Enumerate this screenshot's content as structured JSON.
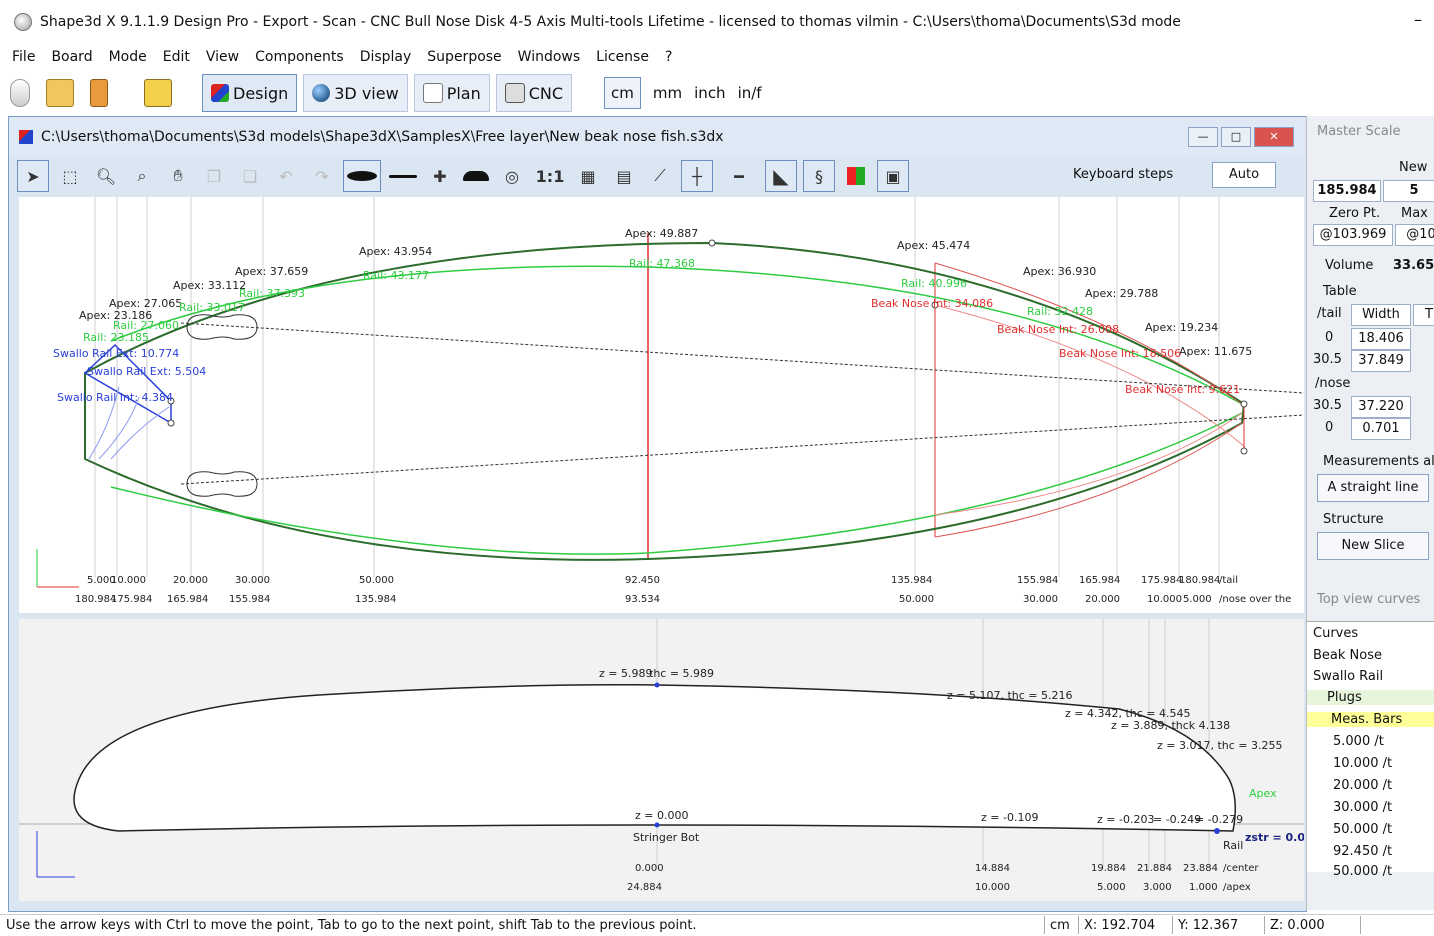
{
  "window": {
    "title": "Shape3d X 9.1.1.9 Design Pro - Export - Scan - CNC Bull Nose Disk 4-5 Axis Multi-tools Lifetime - licensed to thomas vilmin - C:\\Users\\thoma\\Documents\\S3d mode",
    "minimize": "–"
  },
  "menu": [
    "File",
    "Board",
    "Mode",
    "Edit",
    "View",
    "Components",
    "Display",
    "Superpose",
    "Windows",
    "License",
    "?"
  ],
  "modes": {
    "design": "Design",
    "view3d": "3D view",
    "plan": "Plan",
    "cnc": "CNC"
  },
  "units": [
    "cm",
    "mm",
    "inch",
    "in/f"
  ],
  "document": {
    "title": "C:\\Users\\thoma\\Documents\\S3d models\\Shape3dX\\SamplesX\\Free layer\\New beak nose fish.s3dx",
    "ratio_label": "1:1",
    "keyboard_steps": "Keyboard steps",
    "auto": "Auto"
  },
  "top_view": {
    "apex_labels": [
      "Apex: 49.887",
      "Apex: 45.474",
      "Apex: 43.954",
      "Apex: 37.659",
      "Apex: 33.112",
      "Apex: 27.065",
      "Apex: 23.186",
      "Apex: 36.930",
      "Apex: 29.788",
      "Apex: 19.234",
      "Apex: 11.675"
    ],
    "rail_labels": [
      "Rail: 47.368",
      "Rail: 43.177",
      "Rail: 37.393",
      "Rail: 33.017",
      "Rail: 27.060",
      "Rail: 23.185",
      "Rail: 40.996",
      "Rail: 32.428"
    ],
    "beak_labels": [
      "Beak Nose Int: 34.086",
      "Beak Nose Int: 26.008",
      "Beak Nose Int: 18.506",
      "Beak Nose Int: 9.621"
    ],
    "swallo_labels": [
      "Swallo Rail Ext: 10.774",
      "Swallo Rail Ext: 5.504",
      "Swallo Rail Int: 4.384"
    ],
    "tail_values": [
      "5.000",
      "10.000",
      "20.000",
      "30.000",
      "50.000",
      "92.450",
      "135.984",
      "155.984",
      "165.984",
      "175.984",
      "180.984"
    ],
    "nose_values": [
      "180.984",
      "175.984",
      "165.984",
      "155.984",
      "135.984",
      "93.534",
      "50.000",
      "30.000",
      "20.000",
      "10.000",
      "5.000"
    ],
    "tail_suffix": "/tail",
    "nose_suffix": "/nose over the"
  },
  "side_view": {
    "z_labels": [
      "z = 5.989",
      "thc = 5.989",
      "z = 5.107, thc = 5.216",
      "z = 4.342, thc = 4.545",
      "z = 3.889, thck 4.138",
      "z = 3.017, thc = 3.255",
      "z = 0.000",
      "z = -0.109",
      "z = -0.203",
      "= -0.249",
      "= -0.279",
      "Apex",
      "Rail",
      "zstr = 0.00",
      "Stringer Bot"
    ],
    "center_values": [
      "0.000",
      "14.884",
      "19.884",
      "21.884",
      "23.884"
    ],
    "apex_values": [
      "24.884",
      "10.000",
      "5.000",
      "3.000",
      "1.000"
    ],
    "center_suffix": "/center",
    "apex_suffix": "/apex"
  },
  "right_panel": {
    "master_scale": "Master Scale",
    "new": "New",
    "length": "185.984",
    "length2": "5",
    "zero_pt": "Zero Pt.",
    "max": "Max",
    "zero_val": "@103.969",
    "max_val": "@10",
    "volume_label": "Volume",
    "volume": "33.65",
    "table_label": "Table",
    "tail_col": "/tail",
    "width_col": "Width",
    "t_col": "T",
    "rows_tail": [
      [
        "0",
        "18.406"
      ],
      [
        "30.5",
        "37.849"
      ]
    ],
    "nose_label": "/nose",
    "rows_nose": [
      [
        "30.5",
        "37.220"
      ],
      [
        "0",
        "0.701"
      ]
    ],
    "measurements": "Measurements al",
    "straight": "A straight line",
    "structure": "Structure",
    "new_slice": "New Slice",
    "top_view_curves": "Top view curves",
    "curves_header": "Curves",
    "curves": [
      "Beak Nose",
      "Swallo Rail",
      "Plugs",
      "Meas. Bars",
      "5.000 /t",
      "10.000 /t",
      "20.000 /t",
      "30.000 /t",
      "50.000 /t",
      "92.450 /t",
      "50.000 /t"
    ]
  },
  "status": {
    "message": "Use the arrow keys with Ctrl to move the point, Tab to go to the next point, shift Tab to the previous point.",
    "unit": "cm",
    "x": "X: 192.704",
    "y": "Y: 12.367",
    "z": "Z: 0.000"
  },
  "colors": {
    "outline_dark": "#2b6b2b",
    "rail_green": "#2ecc40",
    "beak_red": "#e05555",
    "swallo_blue": "#2a3fd8",
    "panel_yellow": "#ffff99"
  }
}
